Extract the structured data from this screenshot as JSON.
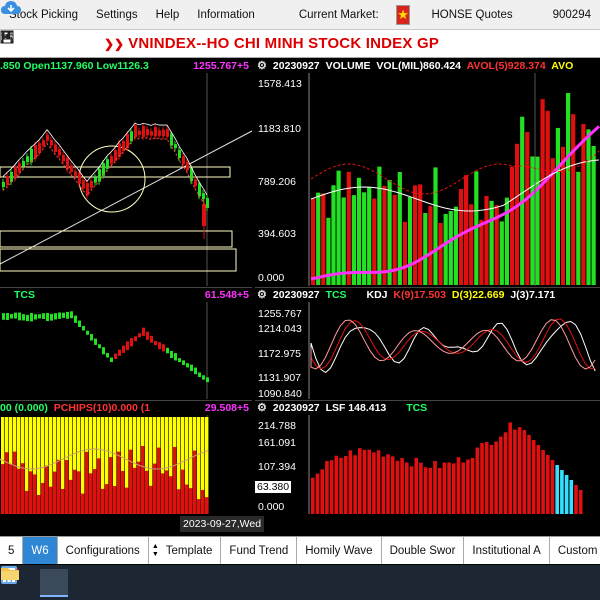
{
  "menu": {
    "items": [
      "Stock Picking",
      "Settings",
      "Help",
      "Information"
    ],
    "market_label": "Current Market:",
    "market_name": "HONSE Quotes",
    "account_fragment": "900294"
  },
  "toolbar": {
    "icons": [
      "pause-icon",
      "add-icon",
      "minus-icon",
      "image-icon",
      "print-icon"
    ],
    "title": "VNINDEX--HO CHI MINH STOCK INDEX  GP"
  },
  "colors": {
    "up": "#22e022",
    "down": "#e01010",
    "yellow": "#ffff00",
    "magenta": "#ff33ff",
    "cyan": "#33e0ff",
    "tab_active": "#2f86d4"
  },
  "panels": {
    "price": {
      "header": [
        ".850 Open1137.960 Low1126.3"
      ],
      "value_tag": "1255.767+5"
    },
    "volume": {
      "date": "20230927",
      "name": "VOLUME",
      "vol": "VOL(MIL)860.424",
      "avol": "AVOL(5)928.374",
      "tail": "AVO",
      "axis": [
        "1578.413",
        "1183.810",
        "789.206",
        "394.603",
        "0.000"
      ]
    },
    "tcs": {
      "name": "TCS",
      "value_tag": "61.548+5"
    },
    "kdj": {
      "date": "20230927",
      "tcs": "TCS",
      "name": "KDJ",
      "k": "K(9)17.503",
      "d": "D(3)22.669",
      "j": "J(3)7.171",
      "axis": [
        "1255.767",
        "1214.043",
        "1172.975",
        "1131.907",
        "1090.840"
      ]
    },
    "pchips": {
      "prefix": "00 (0.000)",
      "name": "PCHIPS(10)0.000 (1",
      "value_tag": "29.508+5"
    },
    "lsf": {
      "date": "20230927",
      "name": "LSF 148.413",
      "tcs": "TCS",
      "axis": [
        "214.788",
        "161.091",
        "107.394",
        "63.380",
        "0.000"
      ]
    }
  },
  "date_box": "2023-09-27,Wed",
  "tabs": [
    {
      "label": "5",
      "active": false
    },
    {
      "label": "W6",
      "active": true
    },
    {
      "label": "Configurations",
      "active": false
    },
    {
      "label": "Template",
      "active": false
    },
    {
      "label": "Fund Trend",
      "active": false
    },
    {
      "label": "Homily Wave",
      "active": false
    },
    {
      "label": "Double Swor",
      "active": false
    },
    {
      "label": "Institutional A",
      "active": false
    },
    {
      "label": "Custom",
      "active": false
    }
  ]
}
